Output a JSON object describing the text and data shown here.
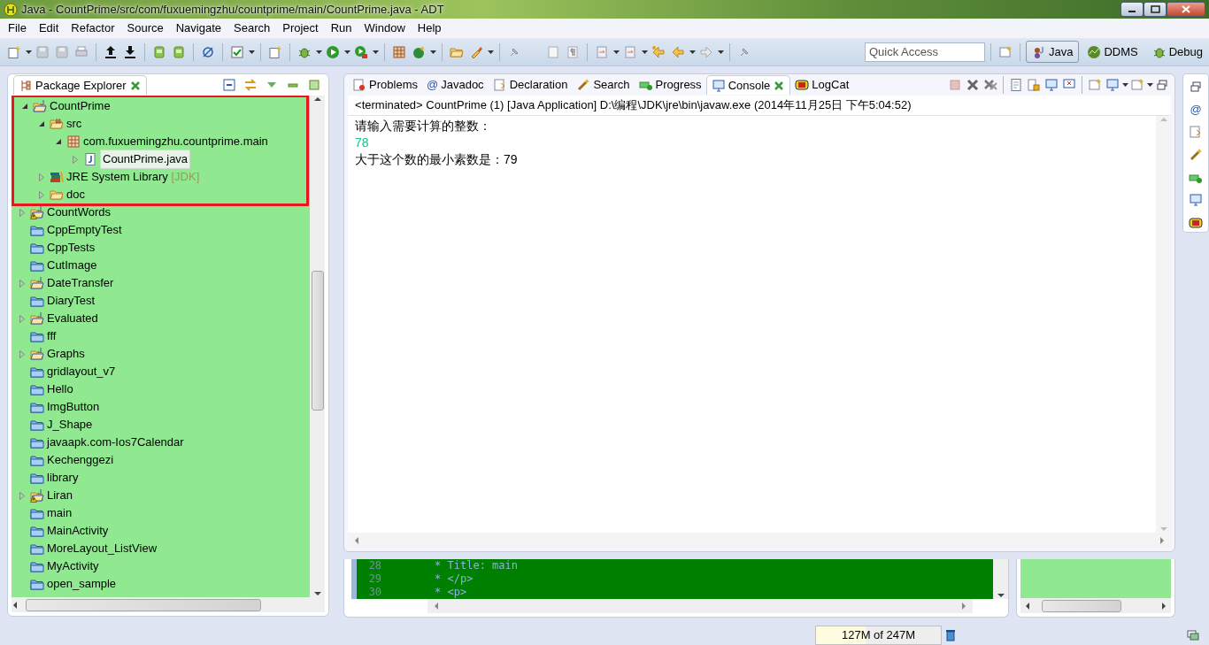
{
  "window": {
    "title": "Java - CountPrime/src/com/fuxuemingzhu/countprime/main/CountPrime.java - ADT"
  },
  "menu": [
    "File",
    "Edit",
    "Refactor",
    "Source",
    "Navigate",
    "Search",
    "Project",
    "Run",
    "Window",
    "Help"
  ],
  "quick_access": {
    "placeholder": "Quick Access"
  },
  "perspectives": [
    {
      "label": "Java",
      "selected": true
    },
    {
      "label": "DDMS",
      "selected": false
    },
    {
      "label": "Debug",
      "selected": false
    }
  ],
  "package_explorer": {
    "title": "Package Explorer",
    "tree": [
      {
        "label": "CountPrime",
        "kind": "java-project",
        "expanded": true,
        "framed": true,
        "warning": false,
        "selected": false,
        "children": [
          {
            "label": "src",
            "kind": "source-folder",
            "expanded": true,
            "selected": false,
            "children": [
              {
                "label": "com.fuxuemingzhu.countprime.main",
                "kind": "package",
                "expanded": true,
                "selected": false,
                "children": [
                  {
                    "label": "CountPrime.java",
                    "kind": "java-file",
                    "expanded": false,
                    "selected": true
                  }
                ]
              }
            ]
          },
          {
            "label": "JRE System Library",
            "decoration": "[JDK]",
            "kind": "library",
            "expanded": false,
            "selected": false
          },
          {
            "label": "doc",
            "kind": "folder",
            "expanded": false,
            "selected": false
          }
        ]
      },
      {
        "label": "CountWords",
        "kind": "java-project",
        "expanded": false,
        "framed": false,
        "warning": true,
        "selected": false
      },
      {
        "label": "CppEmptyTest",
        "kind": "closed-project",
        "framed": false,
        "warning": false,
        "selected": false
      },
      {
        "label": "CppTests",
        "kind": "closed-project",
        "framed": false,
        "warning": false,
        "selected": false
      },
      {
        "label": "CutImage",
        "kind": "closed-project",
        "framed": false,
        "warning": false,
        "selected": false
      },
      {
        "label": "DateTransfer",
        "kind": "java-project",
        "expanded": false,
        "framed": false,
        "warning": false,
        "selected": false
      },
      {
        "label": "DiaryTest",
        "kind": "closed-project",
        "framed": false,
        "warning": false,
        "selected": false
      },
      {
        "label": "Evaluated",
        "kind": "java-project",
        "expanded": false,
        "framed": false,
        "warning": false,
        "selected": false
      },
      {
        "label": "fff",
        "kind": "closed-project",
        "framed": false,
        "warning": false,
        "selected": false
      },
      {
        "label": "Graphs",
        "kind": "java-project",
        "expanded": false,
        "framed": false,
        "warning": false,
        "selected": false
      },
      {
        "label": "gridlayout_v7",
        "kind": "closed-project",
        "framed": false,
        "warning": false,
        "selected": false
      },
      {
        "label": "Hello",
        "kind": "closed-project",
        "framed": false,
        "warning": false,
        "selected": false
      },
      {
        "label": "ImgButton",
        "kind": "closed-project",
        "framed": false,
        "warning": false,
        "selected": false
      },
      {
        "label": "J_Shape",
        "kind": "closed-project",
        "framed": false,
        "warning": false,
        "selected": false
      },
      {
        "label": "javaapk.com-Ios7Calendar",
        "kind": "closed-project",
        "framed": false,
        "warning": false,
        "selected": false
      },
      {
        "label": "Kechenggezi",
        "kind": "closed-project",
        "framed": false,
        "warning": false,
        "selected": false
      },
      {
        "label": "library",
        "kind": "closed-project",
        "framed": false,
        "warning": false,
        "selected": false
      },
      {
        "label": "Liran",
        "kind": "java-project",
        "expanded": false,
        "framed": false,
        "warning": true,
        "selected": false
      },
      {
        "label": "main",
        "kind": "closed-project",
        "framed": false,
        "warning": false,
        "selected": false
      },
      {
        "label": "MainActivity",
        "kind": "closed-project",
        "framed": false,
        "warning": false,
        "selected": false
      },
      {
        "label": "MoreLayout_ListView",
        "kind": "closed-project",
        "framed": false,
        "warning": false,
        "selected": false
      },
      {
        "label": "MyActivity",
        "kind": "closed-project",
        "framed": false,
        "warning": false,
        "selected": false
      },
      {
        "label": "open_sample",
        "kind": "closed-project",
        "framed": false,
        "warning": false,
        "selected": false
      }
    ]
  },
  "console_view": {
    "tabs": [
      {
        "label": "Problems",
        "selected": false
      },
      {
        "label": "Javadoc",
        "glyph": "@",
        "selected": false
      },
      {
        "label": "Declaration",
        "selected": false
      },
      {
        "label": "Search",
        "selected": false
      },
      {
        "label": "Progress",
        "selected": false
      },
      {
        "label": "Console",
        "selected": true
      },
      {
        "label": "LogCat",
        "selected": false
      }
    ],
    "header": "<terminated> CountPrime (1) [Java Application] D:\\编程\\JDK\\jre\\bin\\javaw.exe (2014年11月25日 下午5:04:52)",
    "lines": [
      {
        "kind": "output",
        "text": "请输入需要计算的整数："
      },
      {
        "kind": "input",
        "text": "78"
      },
      {
        "kind": "output",
        "text": "大于这个数的最小素数是：79"
      }
    ]
  },
  "editor": {
    "lines": [
      {
        "number": "28",
        "text": "* Title: main"
      },
      {
        "number": "29",
        "text": "* </p>"
      },
      {
        "number": "30",
        "text": "* <p>"
      }
    ]
  },
  "right_trim": {
    "javadoc_glyph": "@"
  },
  "status_bar": {
    "memory": "127M of 247M",
    "level": 0.4
  }
}
